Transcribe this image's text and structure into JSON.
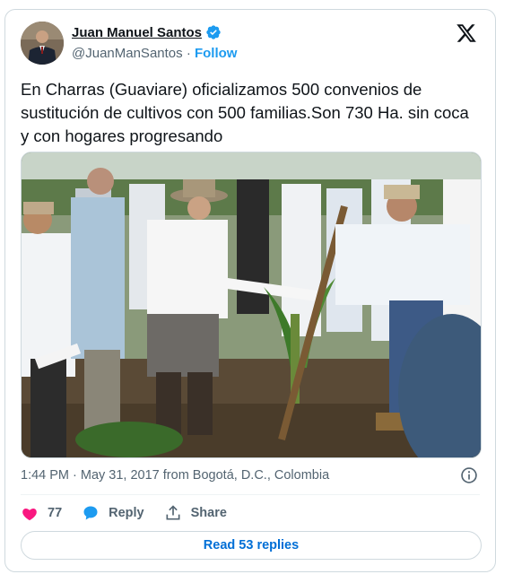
{
  "author": {
    "name": "Juan Manuel Santos",
    "handle": "@JuanManSantos",
    "separator": "·",
    "follow_label": "Follow"
  },
  "tweet": {
    "text": "En Charras (Guaviare) oficializamos 500 convenios de sustitución de cultivos con 500 familias.Son 730 Ha. sin coca y con hogares progresando",
    "timestamp": "1:44 PM · May 31, 2017 from Bogotá, D.C., Colombia"
  },
  "actions": {
    "like_count": "77",
    "reply_label": "Reply",
    "share_label": "Share"
  },
  "read_replies_label": "Read 53 replies",
  "colors": {
    "accent": "#1d9bf0",
    "link": "#006fd6",
    "like": "#f91880",
    "muted": "#536471",
    "border": "#cfd9de"
  },
  "icons": [
    "x-logo-icon",
    "verified-badge-icon",
    "info-icon",
    "heart-icon",
    "reply-bubble-icon",
    "share-icon"
  ]
}
